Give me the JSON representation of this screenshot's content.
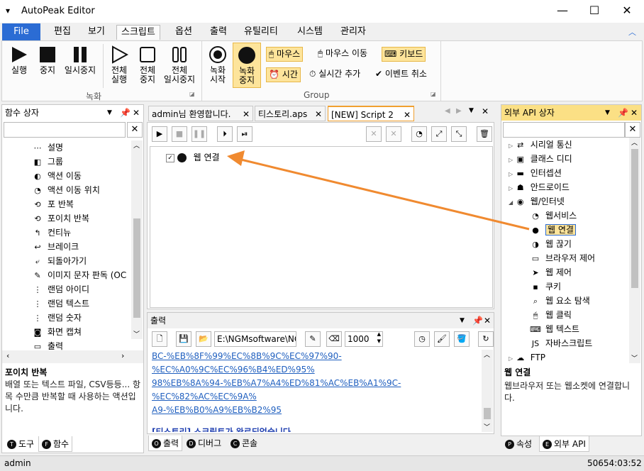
{
  "app": {
    "title": "AutoPeak Editor",
    "minimize": "—",
    "maximize": "☐",
    "close": "✕"
  },
  "menu": [
    "File",
    "편집",
    "보기",
    "스크립트",
    "옵션",
    "출력",
    "유틸리티",
    "시스템",
    "관리자"
  ],
  "ribbon": {
    "run": "실행",
    "stop": "중지",
    "pause": "일시중지",
    "all_run_1": "전체",
    "all_run_2": "실행",
    "all_stop_1": "전체",
    "all_stop_2": "중지",
    "all_pause_1": "전체",
    "all_pause_2": "일시중지",
    "rec_start_1": "녹화",
    "rec_start_2": "시작",
    "rec_stop_1": "녹화",
    "rec_stop_2": "중지",
    "group_record": "녹화",
    "mouse": "마우스",
    "mouse_move": "마우스 이동",
    "keyboard": "키보드",
    "time": "시간",
    "realtime_add": "실시간 추가",
    "event_cancel": "이벤트 취소",
    "group_group": "Group"
  },
  "left_panel": {
    "title": "함수 상자",
    "items": [
      "설명",
      "그룹",
      "액션 이동",
      "액션 이동 위치",
      "포 반복",
      "포이치 반복",
      "컨티뉴",
      "브레이크",
      "되돌아가기",
      "이미지 문자 판독 (OC",
      "랜덤 아이디",
      "랜덤 텍스트",
      "랜덤 숫자",
      "화면 캡쳐",
      "출력"
    ],
    "desc_title": "포이치 반복",
    "desc_text": "배열 또는 텍스트 파일, CSV등등... 항목 수만큼 반복할 때 사용하는 액션입니다.",
    "tabs": [
      "도구",
      "함수"
    ]
  },
  "doc_tabs": [
    "admin님 환영합니다.",
    "티스토리.aps",
    "[NEW] Script 2"
  ],
  "script": {
    "row_label": "웹 연결"
  },
  "output": {
    "title": "출력",
    "path": "E:\\NGMsoftware\\NG",
    "count": "1000",
    "link_lines": [
      "BC-%EB%8F%99%EC%8B%9C%EC%97%90-%EC%A0%9C%EC%96%B4%ED%95%",
      "98%EB%8A%94-%EB%A7%A4%ED%81%AC%EB%A1%9C-%EC%82%AC%EC%9A%",
      "A9-%EB%B0%A9%EB%B2%95"
    ],
    "done": "[티스토리] 스크립트가 완료되었습니다.",
    "tabs": [
      "출력",
      "디버그",
      "콘솔"
    ]
  },
  "right_panel": {
    "title": "외부 API 상자",
    "items": [
      "시리얼 통신",
      "클래스 디디",
      "인터셉션",
      "안드로이드",
      "웹/인터넷",
      "웹서비스",
      "웹 연결",
      "웹 끊기",
      "브라우저 제어",
      "웹 제어",
      "쿠키",
      "웹 요소 탐색",
      "웹 클릭",
      "웹 텍스트",
      "자바스크립트",
      "FTP"
    ],
    "desc_title": "웹 연결",
    "desc_text": "웹브라우저 또는 웹소켓에 연결합니다.",
    "tabs": [
      "속성",
      "외부 API"
    ]
  },
  "status": {
    "user": "admin",
    "time": "50654:03:52"
  },
  "colors": {
    "accent": "#2b6cd4",
    "highlight": "#fde49b",
    "arrow": "#f08a30",
    "link": "#1f5fbf"
  }
}
